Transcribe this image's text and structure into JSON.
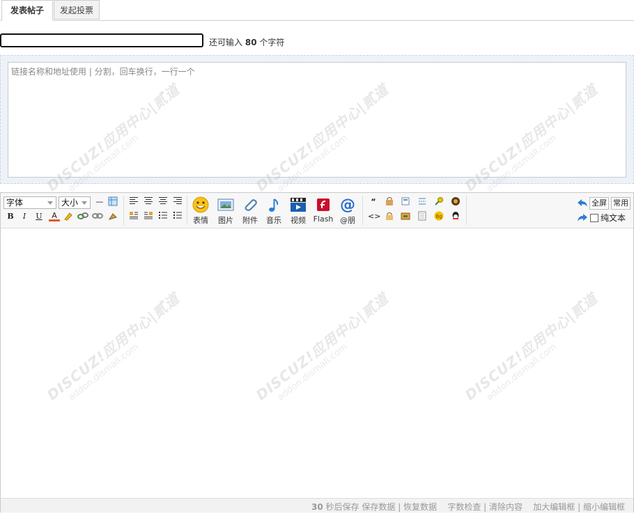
{
  "tabs": [
    {
      "label": "发表帖子",
      "active": true
    },
    {
      "label": "发起投票",
      "active": false
    }
  ],
  "title": {
    "value": "",
    "hint_prefix": "还可输入",
    "hint_count": "80",
    "hint_suffix": "个字符"
  },
  "links": {
    "placeholder": "链接名称和地址使用 | 分割，回车换行，一行一个"
  },
  "toolbar": {
    "font_select": "字体",
    "size_select": "大小",
    "big_buttons": [
      {
        "label": "表情",
        "icon": "smiley-icon"
      },
      {
        "label": "图片",
        "icon": "image-icon"
      },
      {
        "label": "附件",
        "icon": "paperclip-icon"
      },
      {
        "label": "音乐",
        "icon": "music-note-icon"
      },
      {
        "label": "视频",
        "icon": "video-icon"
      },
      {
        "label": "Flash",
        "icon": "flash-icon"
      },
      {
        "label": "@朋",
        "icon": "at-icon"
      }
    ],
    "fullscreen_label": "全屏",
    "common_label": "常用",
    "plaintext_label": "纯文本"
  },
  "status": {
    "autosave_seconds": "30",
    "autosave_text": "秒后保存",
    "save_data": "保存数据",
    "restore_data": "恢复数据",
    "word_check": "字数检查",
    "clear_content": "清除内容",
    "enlarge": "加大编辑框",
    "shrink": "缩小编辑框"
  },
  "watermark": {
    "line1": "DISCUZ!应用中心|贰道",
    "line2": "addon.dismall.com"
  }
}
